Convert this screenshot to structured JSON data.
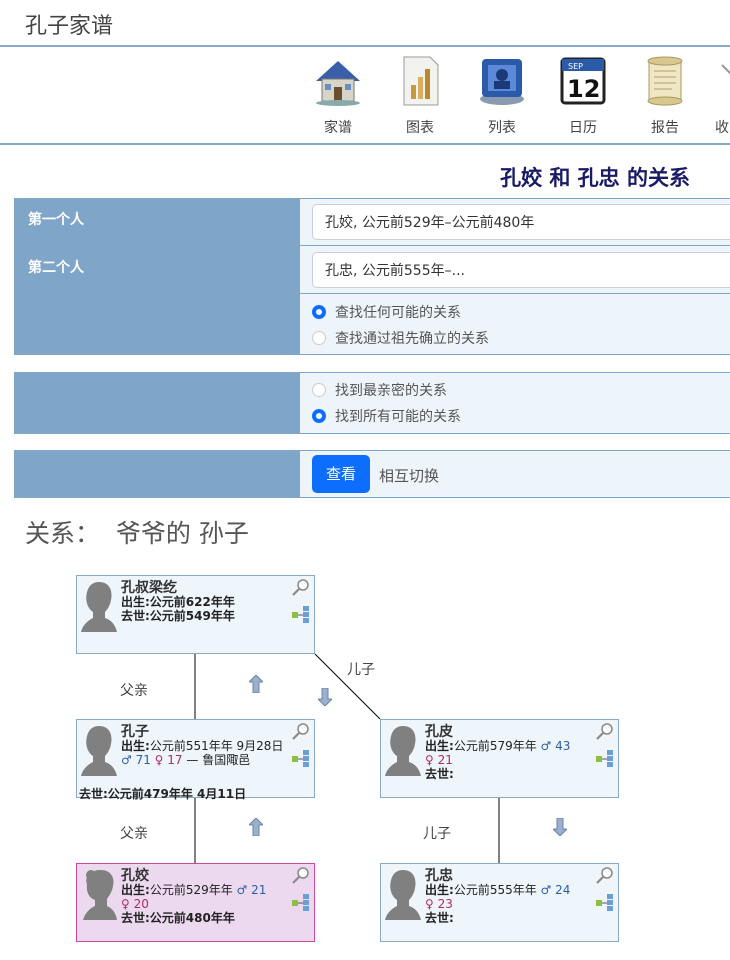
{
  "site": {
    "title": "孔子家谱"
  },
  "nav": [
    {
      "label": "家谱",
      "icon": "house-icon"
    },
    {
      "label": "图表",
      "icon": "chart-document-icon"
    },
    {
      "label": "列表",
      "icon": "list-folder-icon"
    },
    {
      "label": "日历",
      "icon": "calendar-icon"
    },
    {
      "label": "报告",
      "icon": "scroll-icon"
    },
    {
      "label": "收",
      "icon": "partial-icon"
    }
  ],
  "calendar": {
    "month": "SEP",
    "day": "12"
  },
  "page": {
    "heading": "孔姣 和 孔忠 的关系"
  },
  "form": {
    "first_label": "第一个人",
    "first_value": "孔姣, 公元前529年–公元前480年",
    "second_label": "第二个人",
    "second_value": "孔忠, 公元前555年–...",
    "mode_any": "查找任何可能的关系",
    "mode_ancestor": "查找通过祖先确立的关系",
    "find_closest": "找到最亲密的关系",
    "find_all": "找到所有可能的关系",
    "view_button": "查看",
    "swap_link": "相互切换"
  },
  "relation": {
    "text": "关系：  爷爷的 孙子"
  },
  "labels": {
    "father": "父亲",
    "son": "儿子"
  },
  "cards": {
    "p1": {
      "name": "孔叔梁纥",
      "birth": "出生:公元前622年年",
      "death": "去世:公元前549年年"
    },
    "p2": {
      "name": "孔子",
      "birth_label": "出生:",
      "birth": "公元前551年年 9月28日",
      "male": "♂ 71",
      "female": "♀ 17",
      "place": "— 鲁国陬邑",
      "death": "去世:公元前479年年 4月11日"
    },
    "p3": {
      "name": "孔皮",
      "birth_label": "出生:",
      "birth": "公元前579年年",
      "male": "♂ 43",
      "female": "♀ 21",
      "death": "去世:"
    },
    "p4": {
      "name": "孔姣",
      "birth_label": "出生:",
      "birth": "公元前529年年",
      "male": "♂ 21",
      "female": "♀ 20",
      "death": "去世:公元前480年年"
    },
    "p5": {
      "name": "孔忠",
      "birth_label": "出生:",
      "birth": "公元前555年年",
      "male": "♂ 24",
      "female": "♀ 23",
      "death": "去世:"
    }
  },
  "colors": {
    "accent": "#0d6efd",
    "label_bg": "#7fa6c8",
    "heading": "#1a1a66",
    "female_card": "#ecd9ef",
    "male_card": "#eef5fb"
  }
}
